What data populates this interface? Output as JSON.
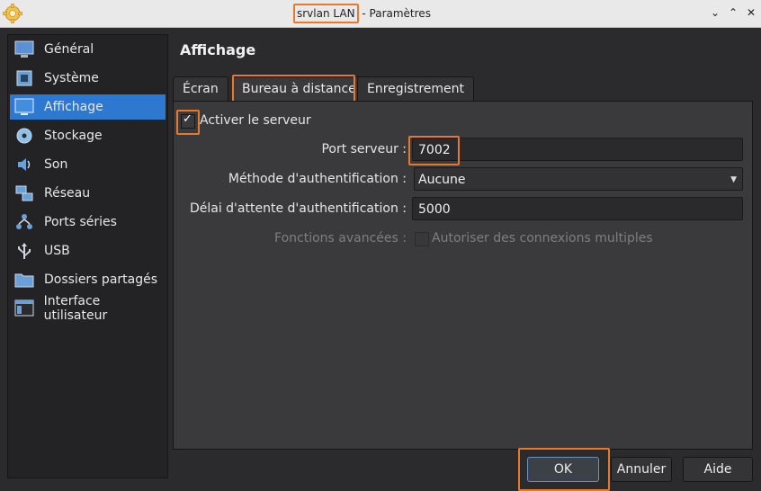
{
  "window": {
    "title_name": "srvlan LAN",
    "title_rest": "- Paramètres",
    "controls": [
      "⌄",
      "⌃",
      "✕"
    ]
  },
  "colors": {
    "accent": "#2f78d0",
    "highlight": "#e8782a"
  },
  "sidebar": {
    "items": [
      {
        "label": "Général",
        "icon": "general-icon"
      },
      {
        "label": "Système",
        "icon": "system-icon"
      },
      {
        "label": "Affichage",
        "icon": "display-icon"
      },
      {
        "label": "Stockage",
        "icon": "storage-icon"
      },
      {
        "label": "Son",
        "icon": "audio-icon"
      },
      {
        "label": "Réseau",
        "icon": "network-icon"
      },
      {
        "label": "Ports séries",
        "icon": "serial-ports-icon"
      },
      {
        "label": "USB",
        "icon": "usb-icon"
      },
      {
        "label": "Dossiers partagés",
        "icon": "shared-folders-icon"
      },
      {
        "label": "Interface utilisateur",
        "icon": "user-interface-icon"
      }
    ],
    "active": "Affichage"
  },
  "main": {
    "title": "Affichage",
    "tabs": [
      {
        "label": "Écran"
      },
      {
        "label": "Bureau à distance"
      },
      {
        "label": "Enregistrement"
      }
    ],
    "active_tab": "Bureau à distance",
    "enable_server": {
      "label": "Activer le serveur",
      "checked": true
    },
    "port": {
      "label": "Port serveur :",
      "value": "7002"
    },
    "auth_method": {
      "label": "Méthode d'authentification :",
      "value": "Aucune"
    },
    "auth_timeout": {
      "label": "Délai d'attente d'authentification :",
      "value": "5000"
    },
    "advanced": {
      "label": "Fonctions avancées :",
      "multi_conn_label": "Autoriser des connexions multiples",
      "checked": false
    }
  },
  "footer": {
    "ok": "OK",
    "cancel": "Annuler",
    "help": "Aide"
  }
}
